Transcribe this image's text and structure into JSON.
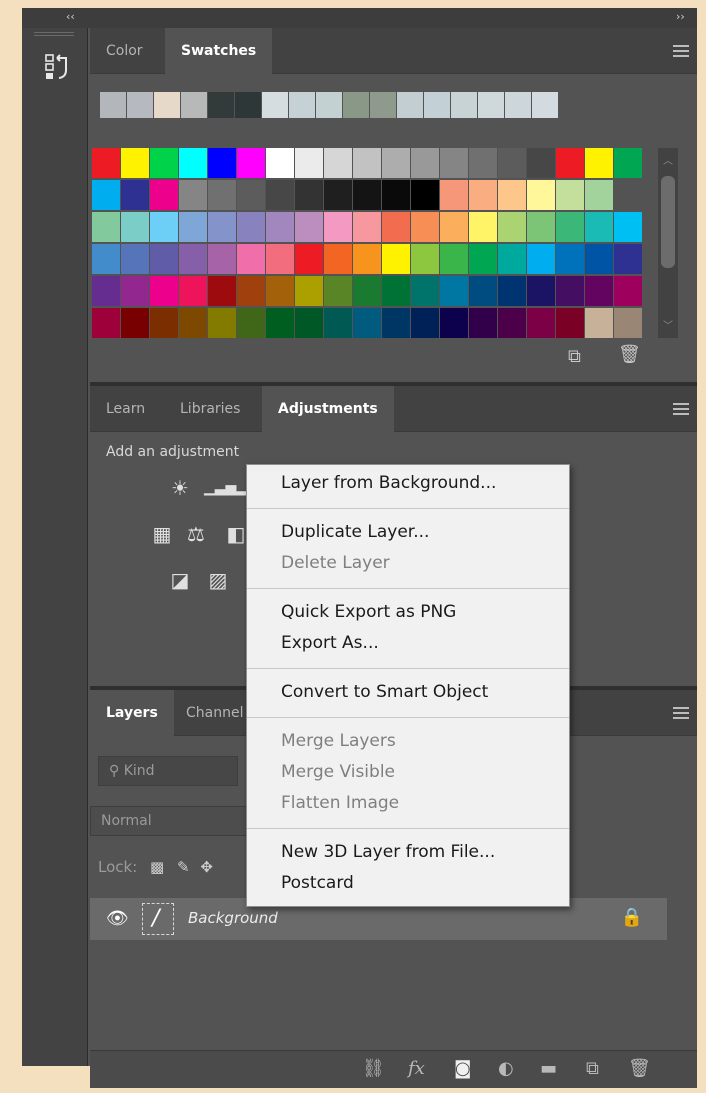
{
  "collapse_left_glyph": "‹‹",
  "collapse_right_glyph": "››",
  "history_icon": "history-panel-icon",
  "swatches_panel": {
    "tabs": [
      {
        "label": "Color",
        "active": false
      },
      {
        "label": "Swatches",
        "active": true
      }
    ],
    "recent_colors": [
      "#b3b6bb",
      "#b6b9c0",
      "#e6d9c9",
      "#b7b9b9",
      "#333a3a",
      "#2e3737",
      "#d5dde0",
      "#c5d1d5",
      "#c3d1d3",
      "#8a9987",
      "#8e9b8c",
      "#c3ced2",
      "#c3d0d6",
      "#c8d3d6",
      "#cfd9dc",
      "#cdd6da",
      "#d4dbe0"
    ],
    "swatch_rows": [
      [
        "#ed1c24",
        "#fff200",
        "#00d34a",
        "#00ffff",
        "#0000ff",
        "#ff00ff",
        "#ffffff",
        "#ebebeb",
        "#d6d6d6",
        "#c2c2c2",
        "#adadad",
        "#999999",
        "#858585",
        "#707070",
        "#5c5c5c",
        "#474747",
        "#ed1c24",
        "#fff200",
        "#00a651"
      ],
      [
        "#00aeef",
        "#2e3192",
        "#ec008c",
        "#858585",
        "#707070",
        "#5c5c5c",
        "#474747",
        "#333333",
        "#1f1f1f",
        "#141414",
        "#0a0a0a",
        "#000000",
        "#f7977a",
        "#f9ad81",
        "#fdc68a",
        "#fff79a",
        "#c4df9b",
        "#a3d39c"
      ],
      [
        "#82ca9d",
        "#7bcdc8",
        "#6ecff6",
        "#7ea7d8",
        "#8493ca",
        "#8882be",
        "#a187be",
        "#bc8dbf",
        "#f49ac2",
        "#f6989d",
        "#f26c4f",
        "#f68e55",
        "#fbaf5c",
        "#fff467",
        "#acd372",
        "#7cc576",
        "#3bb878",
        "#1abbb4",
        "#00bff3"
      ],
      [
        "#438ccb",
        "#5574b9",
        "#605ca8",
        "#855fa8",
        "#a763a8",
        "#f06eaa",
        "#f26d7d",
        "#ed1c24",
        "#f26522",
        "#f7941d",
        "#fff200",
        "#8dc63f",
        "#39b54a",
        "#00a651",
        "#00a99d",
        "#00aeef",
        "#0072bc",
        "#0054a6",
        "#2e3192"
      ],
      [
        "#662d91",
        "#92278f",
        "#ec008c",
        "#ed145b",
        "#9e0b0f",
        "#a0410d",
        "#a36209",
        "#aba000",
        "#598527",
        "#1a7b30",
        "#007236",
        "#00746b",
        "#0076a3",
        "#004b80",
        "#003471",
        "#1b1464",
        "#440e62",
        "#630460",
        "#9e005d"
      ],
      [
        "#9e0039",
        "#790000",
        "#7b2e00",
        "#7d4900",
        "#827b00",
        "#406618",
        "#005e20",
        "#005826",
        "#005952",
        "#005b7f",
        "#003663",
        "#002157",
        "#0d004c",
        "#32004b",
        "#4b0049",
        "#7b0046",
        "#7a0026",
        "#c7b299",
        "#998675"
      ]
    ]
  },
  "adjustments_panel": {
    "tabs": [
      {
        "label": "Learn",
        "active": false
      },
      {
        "label": "Libraries",
        "active": false
      },
      {
        "label": "Adjustments",
        "active": true
      }
    ],
    "hint": "Add an adjustment"
  },
  "layers_panel": {
    "tabs": [
      {
        "label": "Layers",
        "active": true
      },
      {
        "label": "Channel",
        "active": false
      }
    ],
    "filter_placeholder": "Kind",
    "blend_mode": "Normal",
    "lock_label": "Lock:",
    "layer": {
      "name": "Background",
      "visible": true,
      "locked": true
    }
  },
  "context_menu": {
    "groups": [
      [
        {
          "label": "Layer from Background...",
          "enabled": true
        }
      ],
      [
        {
          "label": "Duplicate Layer...",
          "enabled": true
        },
        {
          "label": "Delete Layer",
          "enabled": false
        }
      ],
      [
        {
          "label": "Quick Export as PNG",
          "enabled": true
        },
        {
          "label": "Export As...",
          "enabled": true
        }
      ],
      [
        {
          "label": "Convert to Smart Object",
          "enabled": true
        }
      ],
      [
        {
          "label": "Merge Layers",
          "enabled": false
        },
        {
          "label": "Merge Visible",
          "enabled": false
        },
        {
          "label": "Flatten Image",
          "enabled": false
        }
      ],
      [
        {
          "label": "New 3D Layer from File...",
          "enabled": true
        },
        {
          "label": "Postcard",
          "enabled": true
        }
      ]
    ]
  }
}
